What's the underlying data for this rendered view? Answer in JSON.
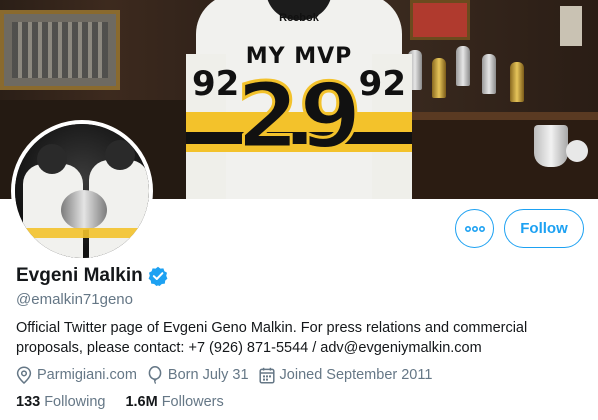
{
  "banner": {
    "jersey_brand": "Reebok",
    "jersey_name": "MY MVP",
    "jersey_number": "29",
    "sleeve_number_left": "92",
    "sleeve_number_right": "92"
  },
  "profile": {
    "display_name": "Evgeni Malkin",
    "verified": true,
    "handle": "@emalkin71geno",
    "bio": "Official Twitter page of Evgeni Geno Malkin. For press relations and commercial proposals, please contact: +7 (926) 871-5544 / adv@evgeniymalkin.com"
  },
  "actions": {
    "more_icon": "more-dots-icon",
    "follow_label": "Follow"
  },
  "meta": {
    "location": "Parmigiani.com",
    "birthday": "Born July 31",
    "joined": "Joined September 2011"
  },
  "stats": {
    "following_count": "133",
    "following_label": "Following",
    "followers_count": "1.6M",
    "followers_label": "Followers"
  },
  "colors": {
    "accent": "#1da1f2",
    "secondary_text": "#657786",
    "primary_text": "#14171a",
    "jersey_gold": "#f3c22b"
  }
}
